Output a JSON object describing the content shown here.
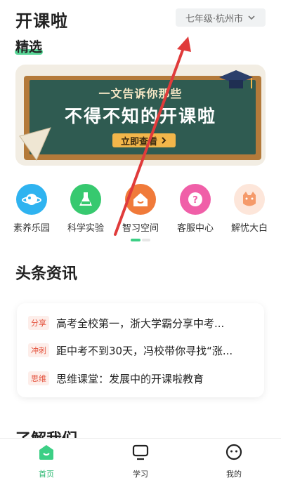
{
  "header": {
    "title": "开课啦",
    "location_selector": {
      "label": "七年级·杭州市",
      "icon": "chevron-down-icon"
    }
  },
  "section_tab": {
    "label": "精选"
  },
  "banner": {
    "line1": "一文告诉你那些",
    "line2": "不得不知的开课啦",
    "button_label": "立即查看",
    "button_icon": "chevron-right-icon"
  },
  "quick_entries": [
    {
      "label": "素养乐园",
      "icon": "planet-icon",
      "color": "#2fb3f0"
    },
    {
      "label": "科学实验",
      "icon": "flask-icon",
      "color": "#37c96f"
    },
    {
      "label": "智习空间",
      "icon": "house-icon",
      "color": "#f07a3a"
    },
    {
      "label": "客服中心",
      "icon": "help-icon",
      "color": "#f05fa8"
    },
    {
      "label": "解忧大白",
      "icon": "cat-icon",
      "color": "#f59a6a"
    }
  ],
  "news": {
    "heading": "头条资讯",
    "items": [
      {
        "tag": "分享",
        "title": "高考全校第一，浙大学霸分享中考..."
      },
      {
        "tag": "冲刺",
        "title": "距中考不到30天，冯校带你寻找“涨..."
      },
      {
        "tag": "思维",
        "title": "思维课堂：发展中的开课啦教育"
      }
    ]
  },
  "about": {
    "heading": "了解我们"
  },
  "bottom_nav": [
    {
      "label": "首页",
      "icon": "home-icon",
      "active": true
    },
    {
      "label": "学习",
      "icon": "monitor-icon",
      "active": false
    },
    {
      "label": "我的",
      "icon": "profile-face-icon",
      "active": false
    }
  ],
  "colors": {
    "accent": "#3ccf85",
    "tag_text": "#e4533e",
    "annotation_arrow": "#e03b3b"
  }
}
